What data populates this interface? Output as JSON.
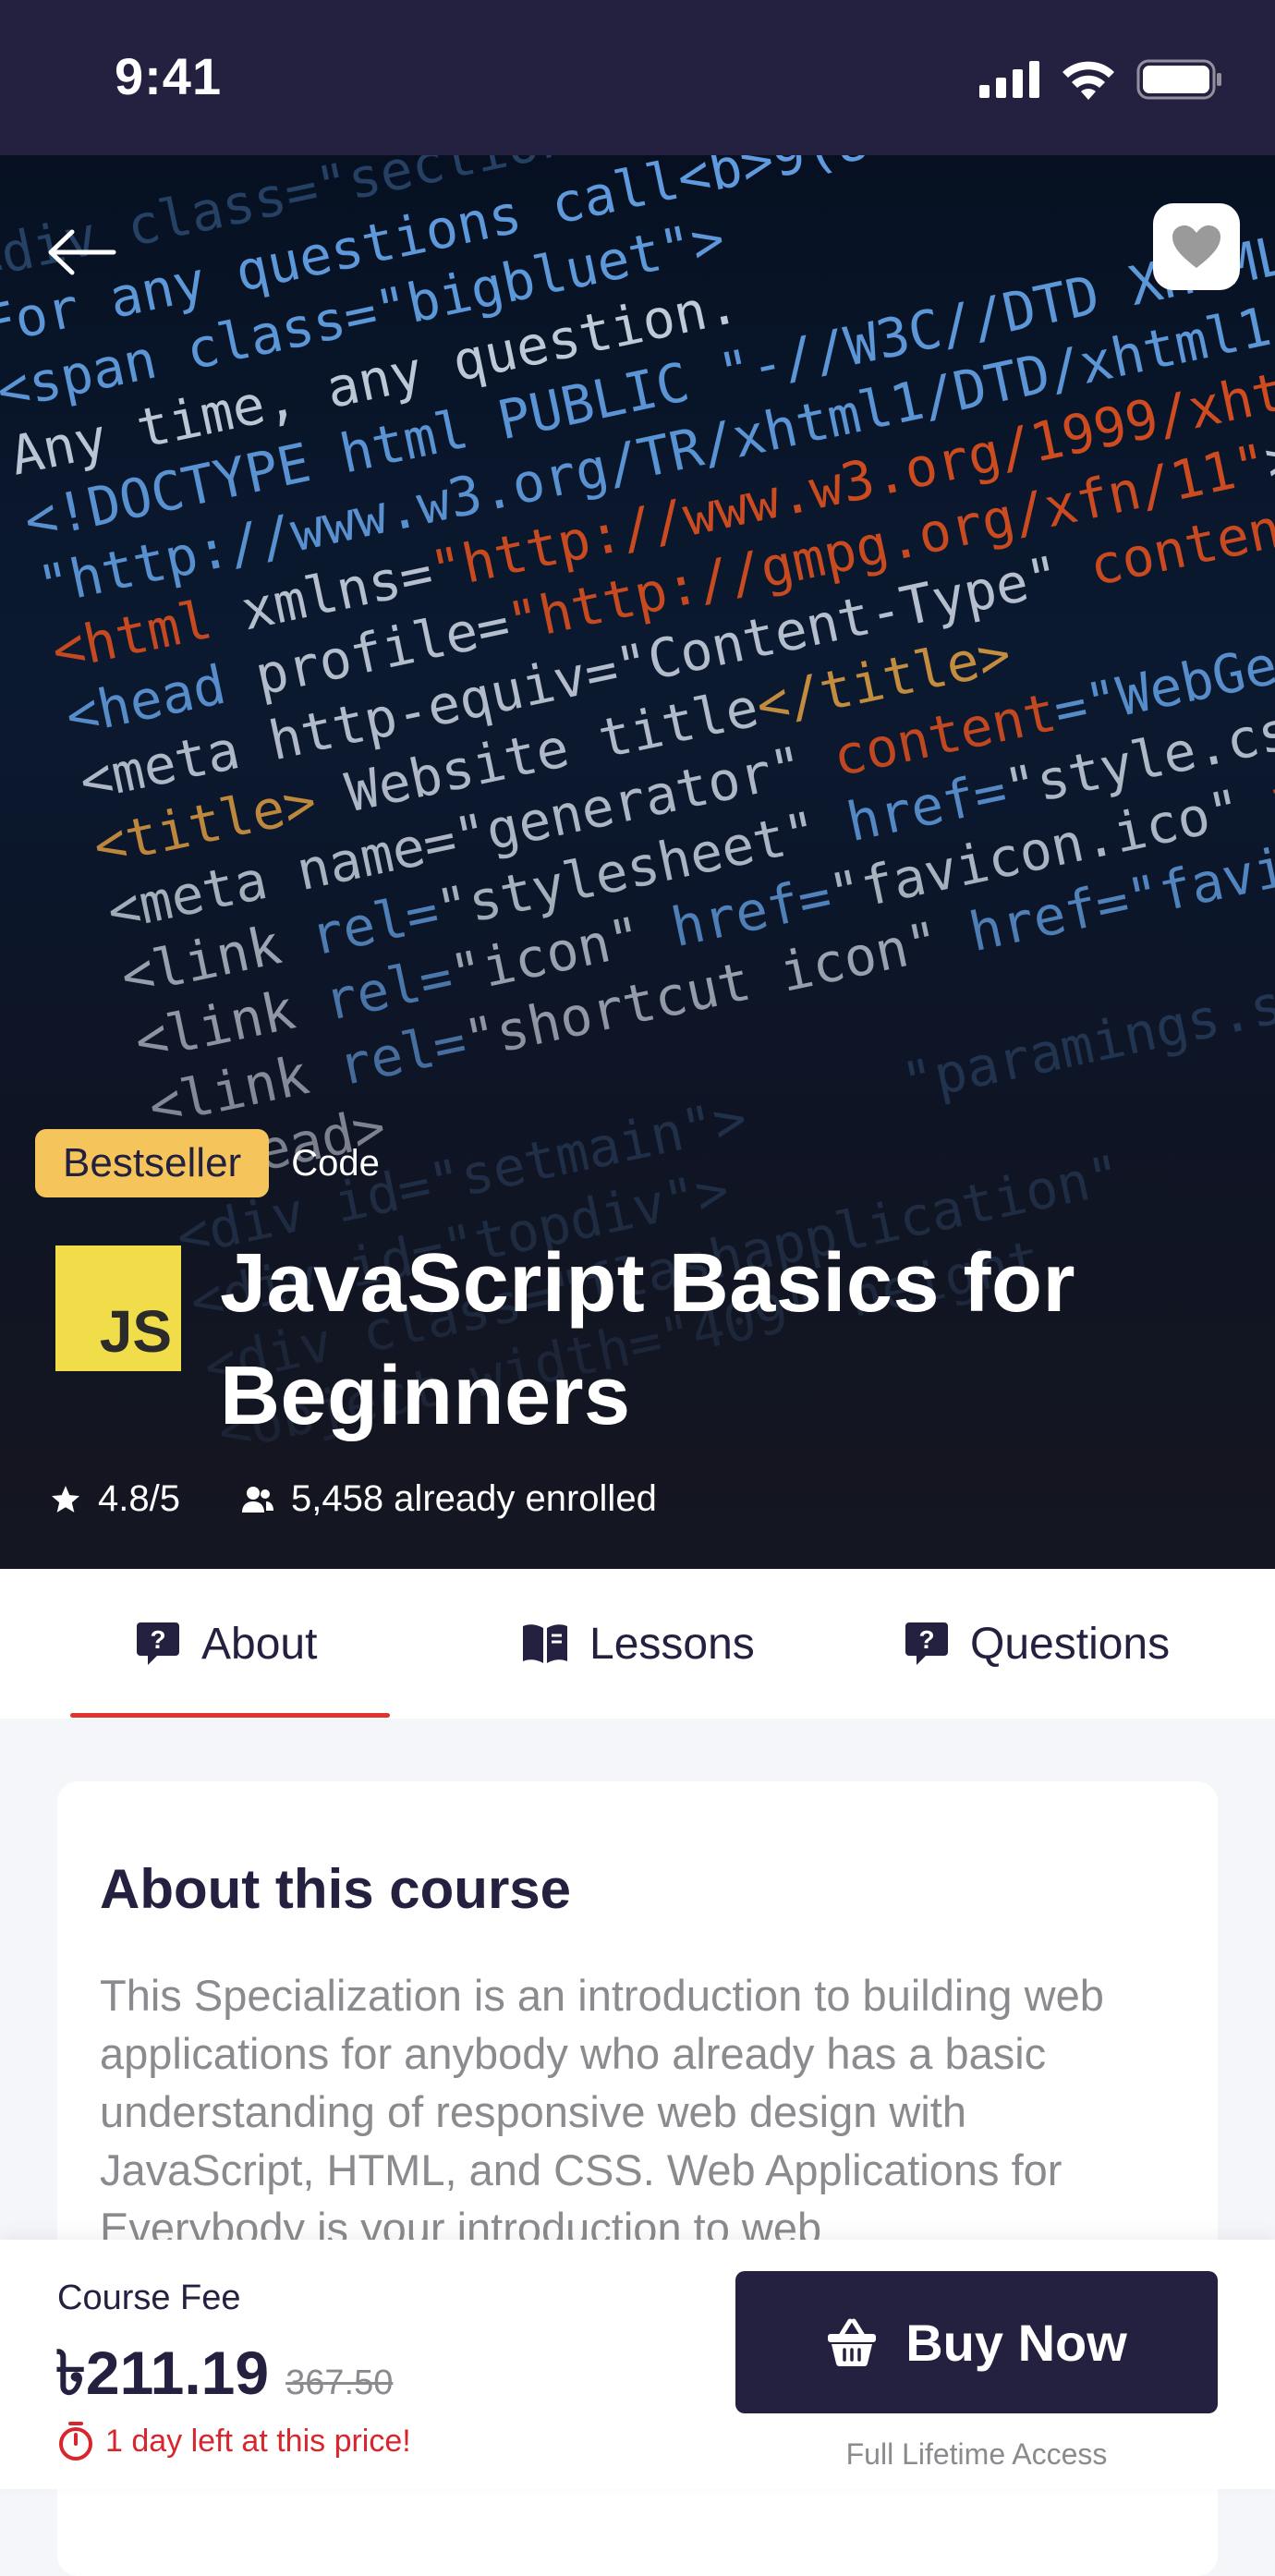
{
  "status_bar": {
    "time": "9:41"
  },
  "hero": {
    "badge": "Bestseller",
    "category": "Code",
    "logo_text": "JS",
    "title": "JavaScript Basics for Beginners",
    "rating": "4.8/5",
    "enrolled": "5,458 already enrolled"
  },
  "tabs": [
    {
      "label": "About",
      "icon": "question-bubble-icon",
      "active": true
    },
    {
      "label": "Lessons",
      "icon": "book-icon",
      "active": false
    },
    {
      "label": "Questions",
      "icon": "question-bubble-icon",
      "active": false
    }
  ],
  "about": {
    "heading": "About this course",
    "text": "This Specialization is an introduction to building web applications for anybody who already has a basic understanding of responsive web design with JavaScript,  HTML, and CSS. Web Applications for Everybody is your introduction to web"
  },
  "purchase": {
    "fee_label": "Course Fee",
    "price": "৳211.19",
    "old_price": "367.50",
    "deadline": "1 day left at this price!",
    "buy_label": "Buy Now",
    "access_note": "Full Lifetime Access"
  },
  "colors": {
    "primary": "#24203f",
    "accent_badge": "#f5c55b",
    "tab_indicator": "#e0342f",
    "deadline": "#d8262c",
    "js_yellow": "#f1dc4a"
  }
}
